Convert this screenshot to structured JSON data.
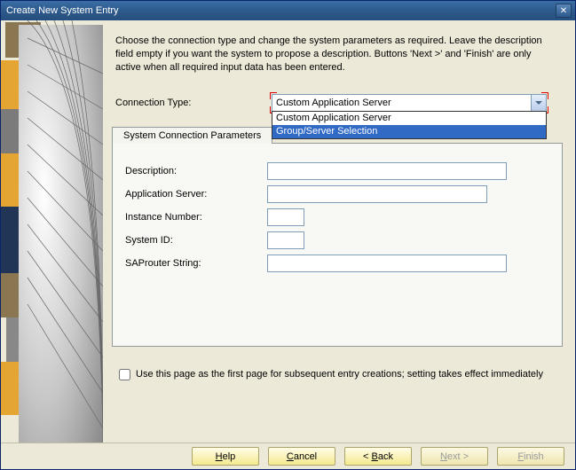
{
  "title": "Create New System Entry",
  "instruction": "Choose the connection type and change the system parameters as required. Leave the description field empty if you want the system to propose a description. Buttons 'Next >' and 'Finish' are only active when all required input data has been entered.",
  "connection_type": {
    "label": "Connection Type:",
    "selected": "Custom Application Server",
    "options": [
      "Custom Application Server",
      "Group/Server Selection"
    ],
    "highlighted_index": 1
  },
  "tab": {
    "label": "System Connection Parameters"
  },
  "form": {
    "description": {
      "label": "Description:",
      "value": ""
    },
    "app_server": {
      "label": "Application Server:",
      "value": ""
    },
    "instance": {
      "label": "Instance Number:",
      "value": ""
    },
    "system_id": {
      "label": "System ID:",
      "value": ""
    },
    "saprouter": {
      "label": "SAProuter String:",
      "value": ""
    }
  },
  "checkbox": {
    "checked": false,
    "label": "Use this page as the first page for subsequent entry creations; setting takes effect immediately"
  },
  "buttons": {
    "help": "Help",
    "cancel": "Cancel",
    "back": "< Back",
    "next": "Next >",
    "finish": "Finish"
  }
}
